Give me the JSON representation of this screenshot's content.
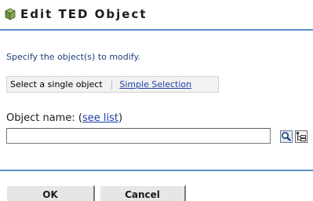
{
  "header": {
    "title": "Edit TED Object",
    "icon": "cube-icon"
  },
  "instruction": "Specify the object(s) to modify.",
  "selection_mode": {
    "current": "Select a single object",
    "separator": "|",
    "alternate_link": "Simple Selection"
  },
  "object_name": {
    "label": "Object name:",
    "link_open": "(",
    "link": "see list",
    "link_close": ")",
    "value": "",
    "browse_icon": "magnifier-icon",
    "history_icon": "history-list-icon"
  },
  "buttons": {
    "ok": "OK",
    "cancel": "Cancel"
  },
  "colors": {
    "rule": "#5b8fc8",
    "link": "#1d3fa8",
    "instruction": "#1f3f7a"
  }
}
